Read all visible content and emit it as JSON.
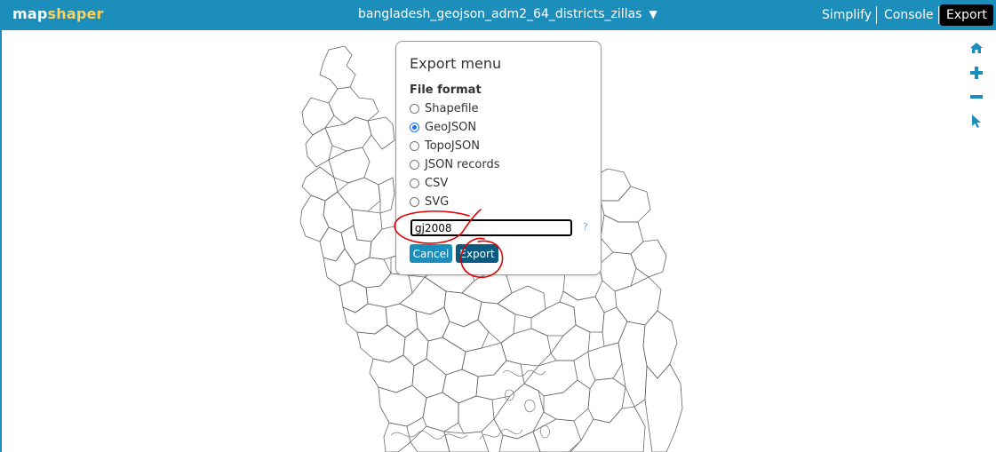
{
  "header": {
    "logo_part1": "map",
    "logo_part2": "shaper",
    "layer_name": "bangladesh_geojson_adm2_64_districts_zillas",
    "layer_caret": "▼",
    "menu": {
      "simplify": "Simplify",
      "console": "Console",
      "export": "Export"
    }
  },
  "tools": [
    "home-icon",
    "zoom-in-icon",
    "zoom-out-icon",
    "pointer-icon"
  ],
  "export_dialog": {
    "title": "Export menu",
    "format_label": "File format",
    "formats": [
      "Shapefile",
      "GeoJSON",
      "TopoJSON",
      "JSON records",
      "CSV",
      "SVG"
    ],
    "selected_format": "GeoJSON",
    "filename_value": "gj2008",
    "help_label": "?",
    "cancel_label": "Cancel",
    "export_label": "Export"
  },
  "colors": {
    "header_bg": "#1c8ebc",
    "logo_accent": "#ffd35a",
    "active_menu_bg": "#000000",
    "export_button": "#0c5a80",
    "annotation": "#e00000"
  }
}
